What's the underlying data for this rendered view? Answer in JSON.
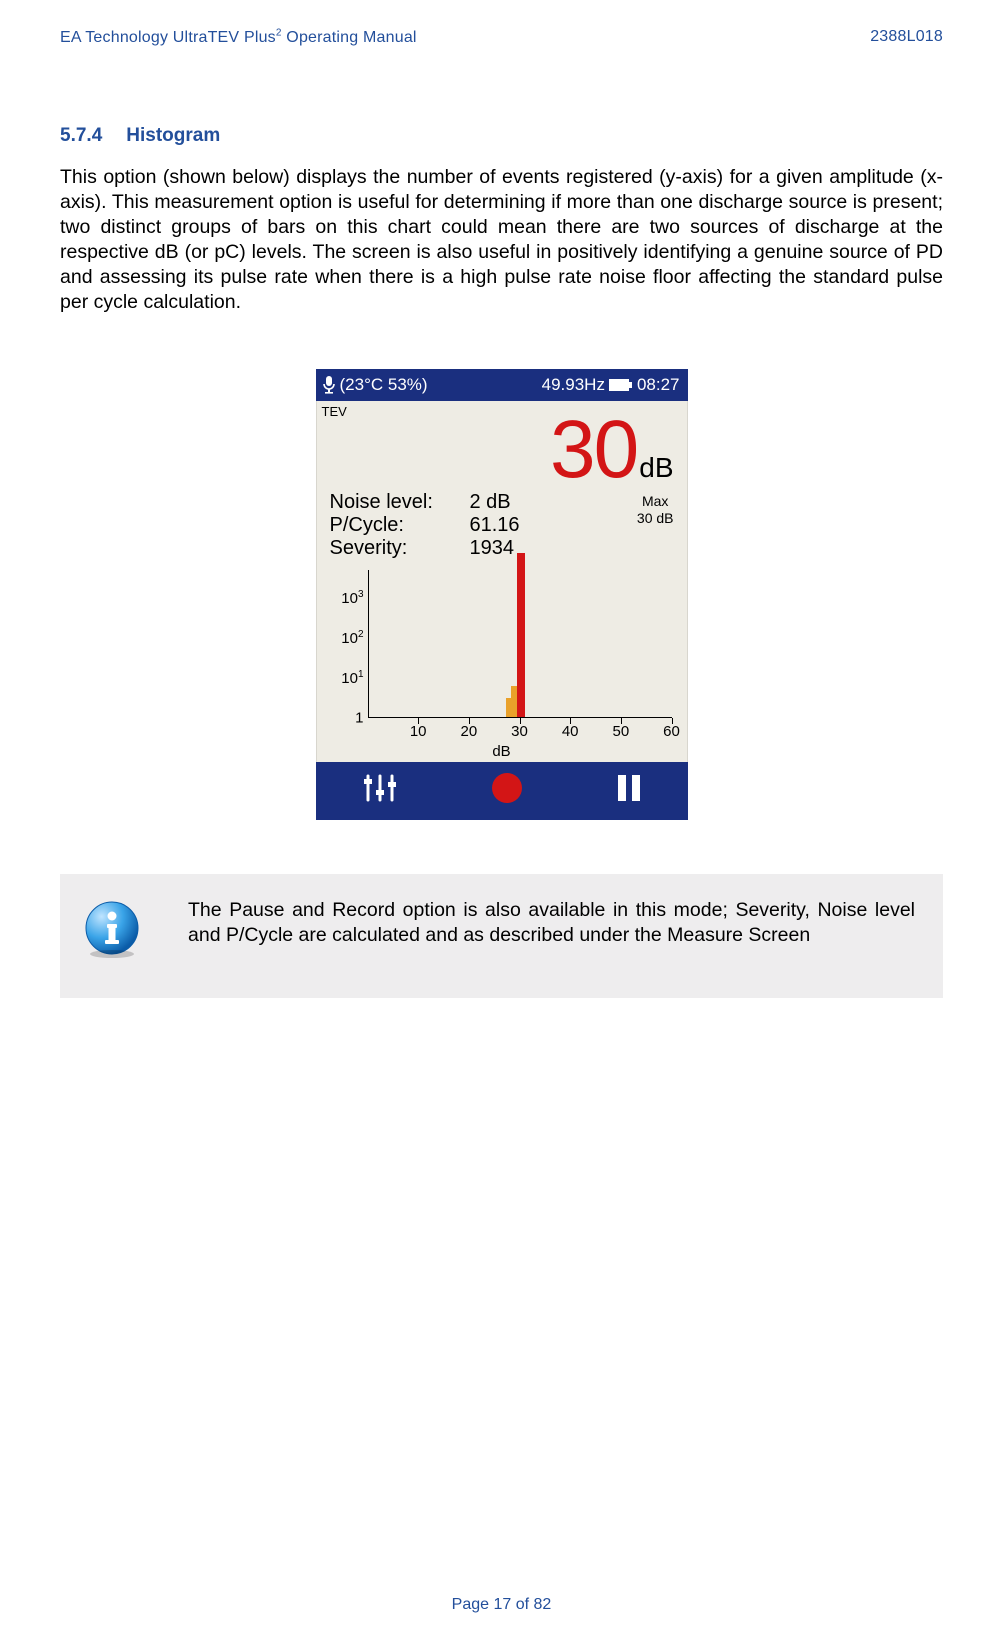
{
  "header": {
    "title_left": "EA Technology UltraTEV Plus² Operating Manual",
    "title_right": "2388L018"
  },
  "section": {
    "number": "5.7.4",
    "title": "Histogram"
  },
  "paragraph": "This option (shown below) displays the number of events registered (y-axis) for a given amplitude (x-axis). This measurement option is useful for determining if more than one discharge source is present; two distinct groups of bars on this chart could mean there are two sources of discharge at the respective dB (or pC) levels.  The screen is also useful in positively identifying a genuine source of PD and assessing its pulse rate when there is a high pulse rate noise floor affecting the standard pulse per cycle calculation.",
  "device": {
    "topbar": {
      "env": "(23°C  53%)",
      "freq": "49.93Hz",
      "time": "08:27"
    },
    "mode": "TEV",
    "reading": {
      "value": "30",
      "unit": "dB"
    },
    "stats": {
      "noise_label": "Noise level:",
      "noise_val": "2 dB",
      "pcycle_label": "P/Cycle:",
      "pcycle_val": "61.16",
      "severity_label": "Severity:",
      "severity_val": "1934",
      "max_label": "Max",
      "max_val": "30 dB"
    }
  },
  "chart_data": {
    "type": "bar",
    "title": "",
    "xlabel": "dB",
    "ylabel": "",
    "x_ticks": [
      10,
      20,
      30,
      40,
      50,
      60
    ],
    "y_ticks": [
      "1",
      "10¹",
      "10²",
      "10³"
    ],
    "ylim": [
      1,
      5000
    ],
    "xlim": [
      0,
      60
    ],
    "bars": [
      {
        "x": 28,
        "value": 3,
        "color": "org"
      },
      {
        "x": 29,
        "value": 6,
        "color": "org"
      },
      {
        "x": 30,
        "value": 5000,
        "color": "red"
      }
    ]
  },
  "callout": "The Pause and Record option is also available in this mode; Severity, Noise level  and P/Cycle are calculated and as described under the Measure Screen",
  "footer": "Page 17 of 82"
}
